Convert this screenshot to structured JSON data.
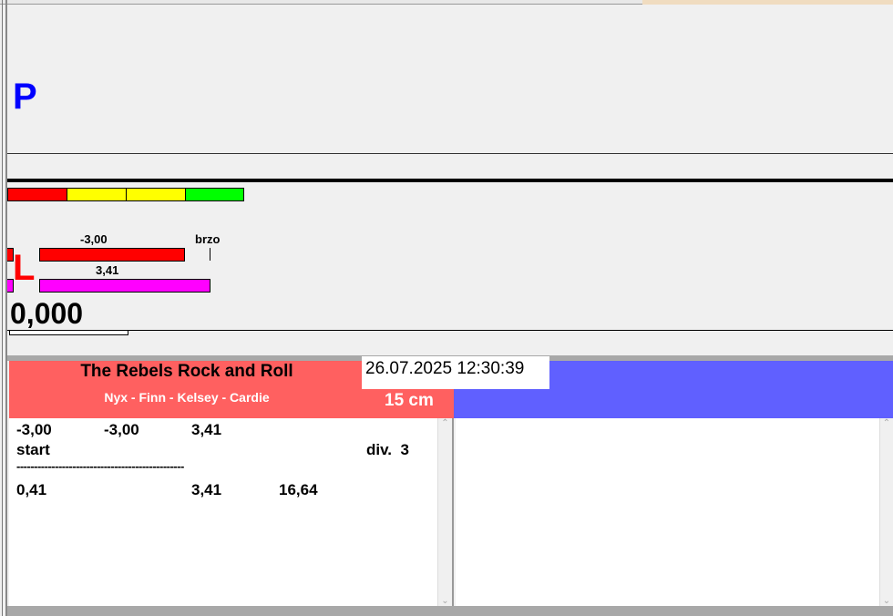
{
  "top": {
    "label_p": "P"
  },
  "meter": {
    "value_top": "-3,00",
    "value_bottom": "3,41",
    "brzo_label": "brzo",
    "lane_label": "L",
    "counter": "0,000",
    "colors": {
      "red": "#ff0000",
      "yellow": "#ffff00",
      "green": "#00ff00",
      "magenta": "#ff00ff"
    }
  },
  "panel": {
    "title": "The Rebels Rock and Roll",
    "subtitle": "Nyx - Finn - Kelsey - Cardie",
    "distance": "15 cm",
    "datetime": "26.07.2025 12:30:39",
    "colors": {
      "header": "#ff6060",
      "blue": "#6060ff"
    },
    "log": {
      "row1": [
        "-3,00",
        "-3,00",
        "3,41"
      ],
      "row2_left": "start",
      "row2_right": "div.  3",
      "separator": "------------------------------------------------",
      "row3": [
        "0,41",
        "3,41",
        "16,64"
      ]
    }
  }
}
